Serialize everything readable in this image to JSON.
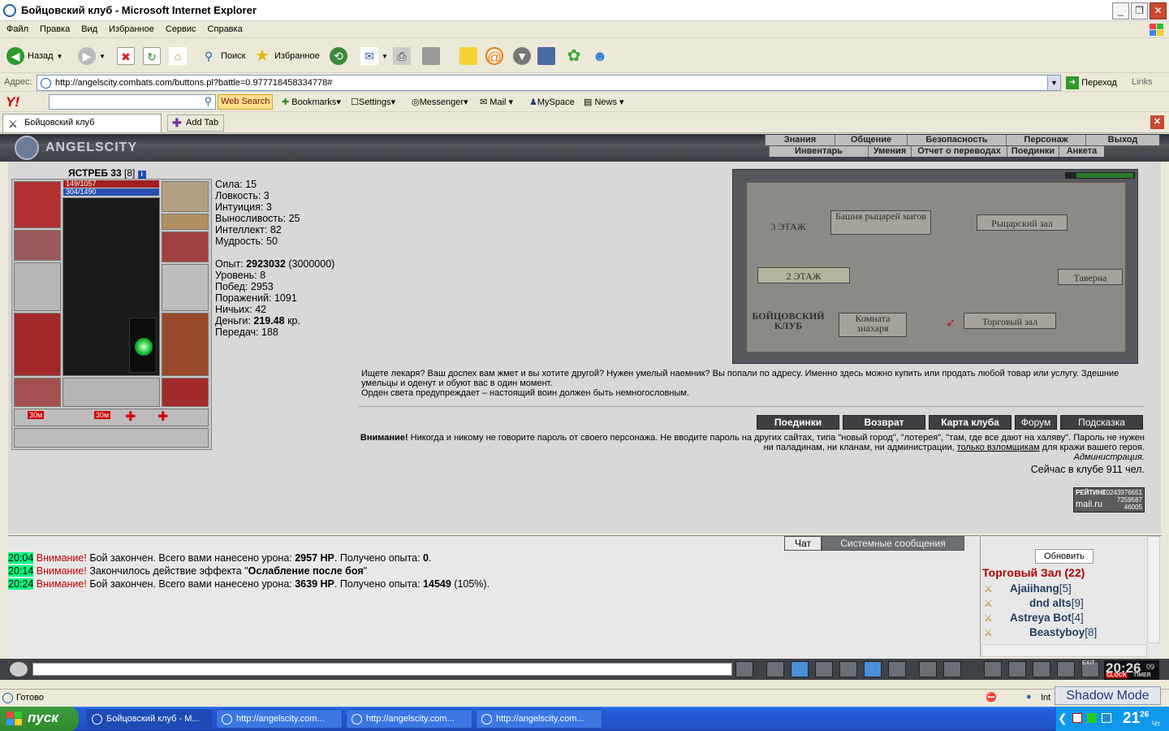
{
  "window": {
    "title": "Бойцовский клуб - Microsoft Internet Explorer"
  },
  "menu": [
    "Файл",
    "Правка",
    "Вид",
    "Избранное",
    "Сервис",
    "Справка"
  ],
  "toolbar": {
    "back": "Назад",
    "search": "Поиск",
    "favorites": "Избранное"
  },
  "address": {
    "label": "Адрес:",
    "url": "http://angelscity.combats.com/buttons.pl?battle=0.977718458334778#",
    "go": "Переход",
    "links": "Links"
  },
  "yahoo": {
    "logo": "Y!",
    "web_search": "Web Search",
    "bookmarks": "Bookmarks",
    "settings": "Settings",
    "messenger": "Messenger",
    "mail": "Mail",
    "myspace": "MySpace",
    "news": "News"
  },
  "tabs": {
    "active": "Бойцовский клуб",
    "add": "Add Tab"
  },
  "game": {
    "logo": "ANGELSCITY",
    "nav_top": [
      "Знания",
      "Общение",
      "Безопасность",
      "Персонаж",
      "Выход"
    ],
    "nav_bottom": [
      "Инвентарь",
      "Умения",
      "Отчет о переводах",
      "Поединки",
      "Анкета"
    ],
    "character": {
      "name": "ЯСТРЕБ 33",
      "level": "[8]",
      "hp": "149/1057",
      "mp": "304/1490",
      "slot_labels": [
        "30м",
        "30м"
      ]
    },
    "stats": [
      "Сила: 15",
      "Ловкость: 3",
      "Интуиция: 3",
      "Выносливость: 25",
      "Интеллект: 82",
      "Мудрость: 50"
    ],
    "exp": {
      "label": "Опыт:",
      "value": "2923032",
      "next": "(3000000)"
    },
    "stats2": [
      "Уровень: 8",
      "Побед: 2953",
      "Поражений: 1091",
      "Ничьих: 42"
    ],
    "money": {
      "label": "Деньги:",
      "value": "219.48",
      "unit": "кр."
    },
    "transfers": "Передач: 188",
    "map": {
      "floor3": "3 ЭТАЖ",
      "floor2": "2 ЭТАЖ",
      "club": "БОЙЦОВСКИЙ КЛУБ",
      "rooms": [
        "Башня рыцарей магов",
        "Рыцарский зал",
        "Таверна",
        "Комната знахаря",
        "Торговый зал"
      ]
    },
    "info": [
      "Ищете лекаря? Ваш доспех вам жмет и вы хотите другой? Нужен умелый наемник? Вы попали по адресу. Именно здесь можно купить или продать любой товар или услугу. Здешние умельцы и оденут и обуют вас в один момент.",
      "Орден света предупреждает – настоящий воин должен быть немногословным."
    ],
    "buttons": [
      "Поединки",
      "Возврат",
      "Карта клуба",
      "Форум",
      "Подсказка"
    ],
    "warning": {
      "bold": "Внимание!",
      "text": "Никогда и никому не говорите пароль от своего персонажа. Не вводите пароль на других сайтах, типа \"новый город\", \"лотерея\", \"там, где все дают на халяву\". Пароль не нужен ни паладинам, ни кланам, ни администрации,",
      "link": "только взломщикам",
      "tail": "для кражи вашего героя.",
      "sign": "Администрация."
    },
    "online": "Сейчас в клубе 911 чел.",
    "rating": {
      "label": "РЕЙТИНГ",
      "n1": "10243976651",
      "n2": "7259587",
      "n3": "46005",
      "brand": "mail.ru"
    }
  },
  "chat": {
    "tabs": [
      "Чат",
      "Системные сообщения"
    ],
    "lines": [
      {
        "time": "20:04",
        "warn": "Внимание!",
        "text1": "Бой закончен. Всего вами нанесено урона:",
        "b1": "2957 HP",
        "text2": ". Получено опыта:",
        "b2": "0",
        "text3": "."
      },
      {
        "time": "20:14",
        "warn": "Внимание!",
        "text1": "Закончилось действие эффекта \"",
        "b1": "Ослабление после боя",
        "text2": "\"",
        "b2": "",
        "text3": ""
      },
      {
        "time": "20:24",
        "warn": "Внимание!",
        "text1": "Бой закончен. Всего вами нанесено урона:",
        "b1": "3639 HP",
        "text2": ". Получено опыта:",
        "b2": "14549",
        "text3": " (105%)."
      }
    ]
  },
  "online_panel": {
    "refresh": "Обновить",
    "room": "Торговый Зал (22)",
    "users": [
      {
        "name": "Ajaiihang",
        "level": "[5]"
      },
      {
        "name": "dnd alts",
        "level": "[9]"
      },
      {
        "name": "Astreya Bot",
        "level": "[4]"
      },
      {
        "name": "Beastyboy",
        "level": "[8]"
      }
    ]
  },
  "clock": {
    "time": "20:26",
    "seconds": "09",
    "label1": "CLOCK",
    "label2": "TIMER",
    "exit": "EXIT"
  },
  "status": {
    "text": "Готово",
    "zone": "Int"
  },
  "shadow_mode": "Shadow Mode",
  "taskbar": {
    "start": "пуск",
    "tasks": [
      "Бойцовский клуб - М...",
      "http://angelscity.com...",
      "http://angelscity.com...",
      "http://angelscity.com..."
    ],
    "time": "21",
    "time_min": "26",
    "day": "Чт"
  },
  "colors": {
    "hp": "#a31f1f",
    "mp": "#2a4fb0",
    "time_highlight": "#00ff80",
    "warn": "#c00000",
    "room": "#b00000",
    "user": "#213d5e"
  }
}
